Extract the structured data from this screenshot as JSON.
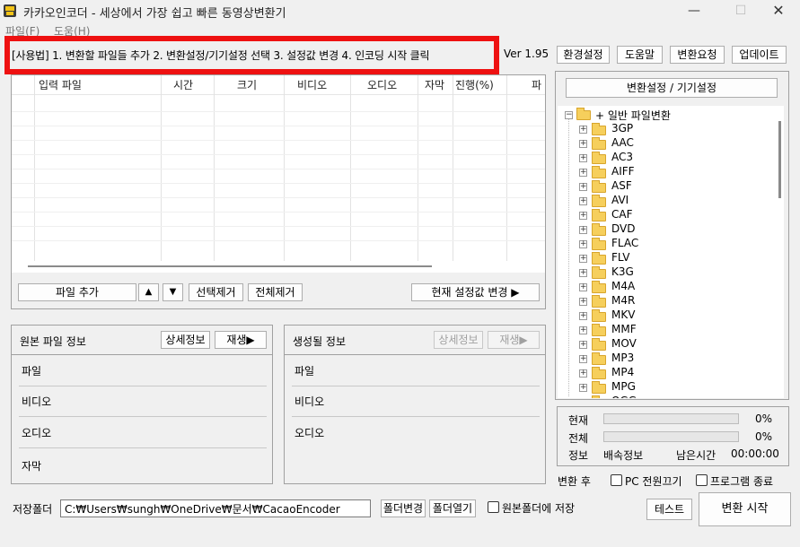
{
  "window": {
    "title": "카카오인코더 - 세상에서 가장 쉽고 빠른 동영상변환기",
    "min_label": "—",
    "max_label": "☐",
    "close_label": "✕"
  },
  "menu": {
    "file": "파일(F)",
    "help": "도움(H)"
  },
  "usage": {
    "text": "[사용법] 1. 변환할 파일들 추가   2. 변환설정/기기설정 선택   3. 설정값 변경   4. 인코딩 시작 클릭",
    "highlight_color": "#ee1111"
  },
  "version": "Ver 1.95",
  "top_buttons": {
    "env": "환경설정",
    "help": "도움말",
    "request": "변환요청",
    "update": "업데이트"
  },
  "file_list": {
    "columns": [
      "입력 파일",
      "시간",
      "크기",
      "비디오",
      "오디오",
      "자막",
      "진행(%)",
      "파"
    ]
  },
  "list_buttons": {
    "add_file": "파일 추가",
    "up": "▲",
    "down": "▼",
    "delete_selected": "선택제거",
    "delete_all": "전체제거",
    "current_settings": "현재 설정값 변경 ▶"
  },
  "source_panel": {
    "title": "원본 파일 정보",
    "detail_btn": "상세정보",
    "play_btn": "재생▶",
    "rows": [
      "파일",
      "비디오",
      "오디오",
      "자막"
    ]
  },
  "output_panel": {
    "title": "생성될 정보",
    "detail_btn": "상세정보",
    "play_btn": "재생▶",
    "rows": [
      "파일",
      "비디오",
      "오디오"
    ]
  },
  "tree": {
    "header_btn": "변환설정 / 기기설정",
    "root": "+ 일반 파일변환",
    "items": [
      "3GP",
      "AAC",
      "AC3",
      "AIFF",
      "ASF",
      "AVI",
      "CAF",
      "DVD",
      "FLAC",
      "FLV",
      "K3G",
      "M4A",
      "M4R",
      "MKV",
      "MMF",
      "MOV",
      "MP3",
      "MP4",
      "MPG",
      "OGG"
    ]
  },
  "progress": {
    "current_label": "현재",
    "current_pct": "0%",
    "current_value": 0,
    "total_label": "전체",
    "total_pct": "0%",
    "total_value": 0,
    "info_label": "정보",
    "info_value": "배속정보",
    "remaining_label": "남은시간",
    "remaining_value": "00:00:00"
  },
  "after": {
    "label": "변환 후",
    "pc_off": "PC 전원끄기",
    "program_exit": "프로그램 종료",
    "pc_off_checked": false,
    "program_exit_checked": false
  },
  "bottom": {
    "save_label": "저장폴더",
    "save_path": "C:₩Users₩sungh₩OneDrive₩문서₩CacaoEncoder",
    "change_folder": "폴더변경",
    "open_folder": "폴더열기",
    "save_in_source": "원본폴더에 저장",
    "save_in_source_checked": false,
    "test_btn": "테스트",
    "start_btn": "변환 시작"
  }
}
